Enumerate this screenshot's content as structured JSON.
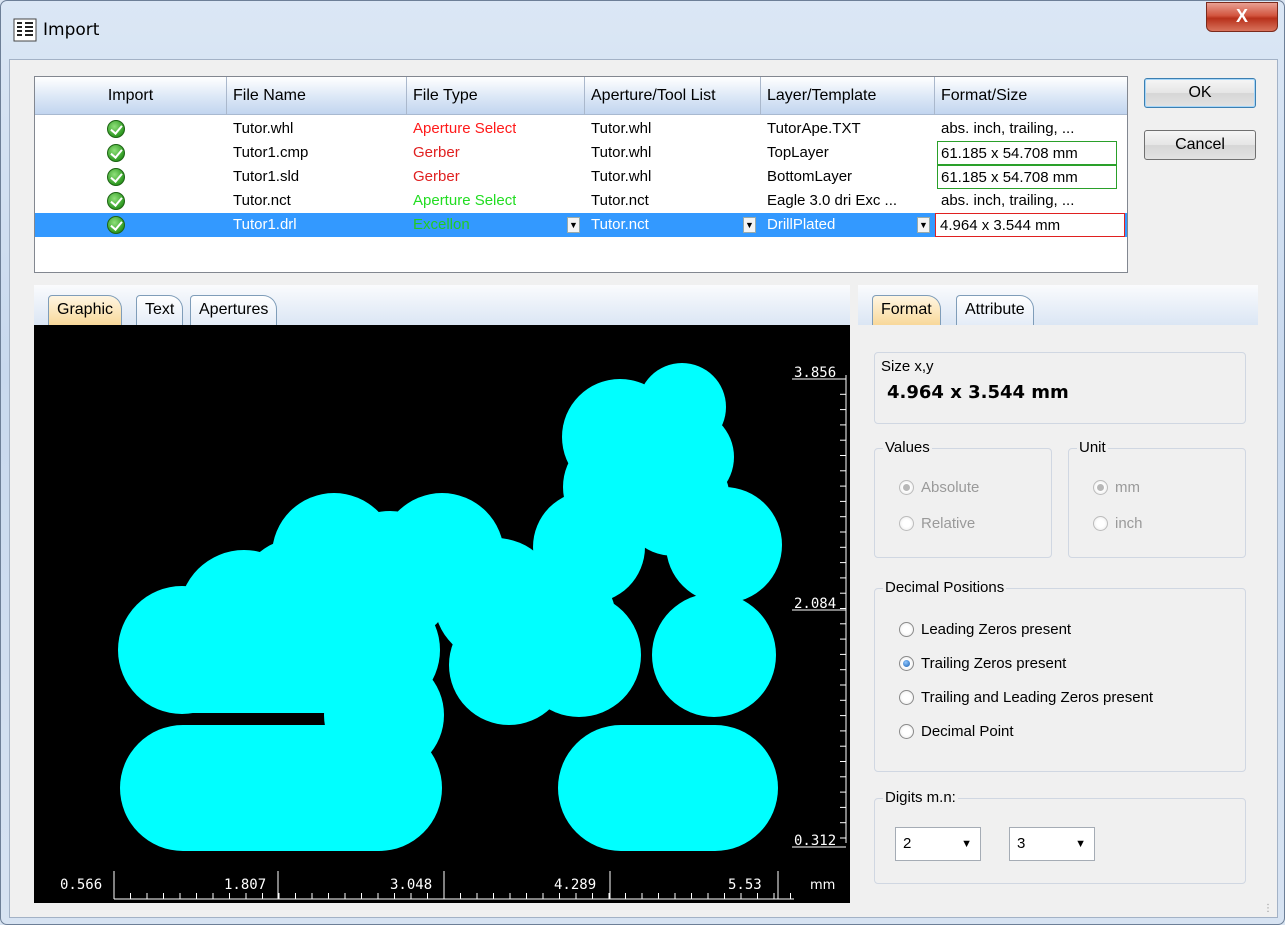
{
  "window": {
    "title": "Import",
    "close_label": "X"
  },
  "table": {
    "headers": [
      "Import",
      "File Name",
      "File Type",
      "Aperture/Tool List",
      "Layer/Template",
      "Format/Size"
    ],
    "rows": [
      {
        "file_name": "Tutor.whl",
        "file_type": "Aperture Select",
        "file_type_color": "#ff1a1a",
        "aperture": "Tutor.whl",
        "layer": "TutorApe.TXT",
        "format": "abs. inch, trailing, ..."
      },
      {
        "file_name": "Tutor1.cmp",
        "file_type": "Gerber",
        "file_type_color": "#e02020",
        "aperture": "Tutor.whl",
        "layer": "TopLayer",
        "format": "61.185 x 54.708 mm"
      },
      {
        "file_name": "Tutor1.sld",
        "file_type": "Gerber",
        "file_type_color": "#e02020",
        "aperture": "Tutor.whl",
        "layer": "BottomLayer",
        "format": "61.185 x 54.708 mm"
      },
      {
        "file_name": "Tutor.nct",
        "file_type": "Aperture Select",
        "file_type_color": "#22dd22",
        "aperture": "Tutor.nct",
        "layer": "Eagle 3.0 dri Exc ...",
        "format": "abs. inch, trailing, ..."
      },
      {
        "file_name": "Tutor1.drl",
        "file_type": "Excellon",
        "file_type_color": "#22cc22",
        "aperture": "Tutor.nct",
        "layer": "DrillPlated",
        "format": "4.964 x 3.544 mm"
      }
    ],
    "selected_row": 4
  },
  "buttons": {
    "ok": "OK",
    "cancel": "Cancel"
  },
  "left_tabs": [
    "Graphic",
    "Text",
    "Apertures"
  ],
  "right_tabs": [
    "Format",
    "Attribute"
  ],
  "graphic": {
    "shape_color": "#00ffff",
    "y_ticks": [
      "3.856",
      "2.084",
      "0.312"
    ],
    "x_ticks": [
      "0.566",
      "1.807",
      "3.048",
      "4.289",
      "5.53"
    ],
    "unit": "mm"
  },
  "size_group": {
    "title": "Size x,y",
    "value": "4.964 x 3.544 mm"
  },
  "values_group": {
    "title": "Values",
    "options": [
      "Absolute",
      "Relative"
    ],
    "selected": "Absolute"
  },
  "unit_group": {
    "title": "Unit",
    "options": [
      "mm",
      "inch"
    ],
    "selected": "mm"
  },
  "decimal_group": {
    "title": "Decimal Positions",
    "options": [
      "Leading Zeros present",
      "Trailing Zeros present",
      "Trailing and Leading Zeros present",
      "Decimal Point"
    ],
    "selected": "Trailing Zeros present"
  },
  "digits_group": {
    "title": "Digits m.n:",
    "m": "2",
    "n": "3"
  }
}
